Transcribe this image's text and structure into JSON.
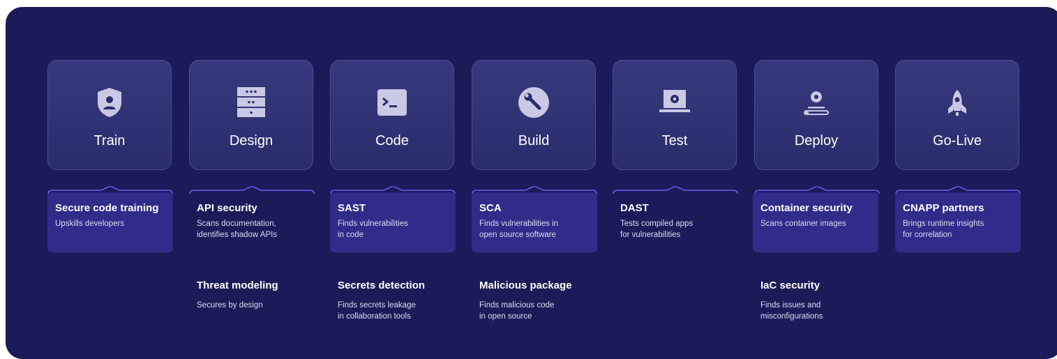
{
  "stages": [
    {
      "label": "Train",
      "icon": "shield-user-icon"
    },
    {
      "label": "Design",
      "icon": "server-rack-icon"
    },
    {
      "label": "Code",
      "icon": "terminal-icon"
    },
    {
      "label": "Build",
      "icon": "wrench-icon"
    },
    {
      "label": "Test",
      "icon": "laptop-gear-icon"
    },
    {
      "label": "Deploy",
      "icon": "gear-progress-icon"
    },
    {
      "label": "Go-Live",
      "icon": "rocket-icon"
    }
  ],
  "tools": [
    {
      "title": "Secure code training",
      "desc": "Upskills developers"
    },
    {
      "title": "API security",
      "desc": "Scans documentation,\nidentifies shadow APIs"
    },
    {
      "title": "SAST",
      "desc": "Finds vulnerabilities\nin code"
    },
    {
      "title": "SCA",
      "desc": "Finds vulnerabilities in\nopen source software"
    },
    {
      "title": "DAST",
      "desc": "Tests compiled apps\nfor vulnerabilities"
    },
    {
      "title": "Container security",
      "desc": "Scans container images"
    },
    {
      "title": "CNAPP partners",
      "desc": "Brings runtime insights\nfor correlation"
    }
  ],
  "secondary": [
    {
      "title": "Threat modeling",
      "desc": "Secures by design"
    },
    {
      "title": "Secrets detection",
      "desc": "Finds secrets leakage\nin collaboration tools"
    },
    {
      "title": "Malicious package",
      "desc": "Finds malicious code\nin open source"
    },
    {
      "title": "IaC security",
      "desc": "Finds issues and\nmisconfigurations"
    }
  ],
  "colors": {
    "background": "#1b1b5a",
    "card": "#2f2c8a",
    "accent": "#6b5cf0",
    "icon": "#c9c9e6"
  }
}
